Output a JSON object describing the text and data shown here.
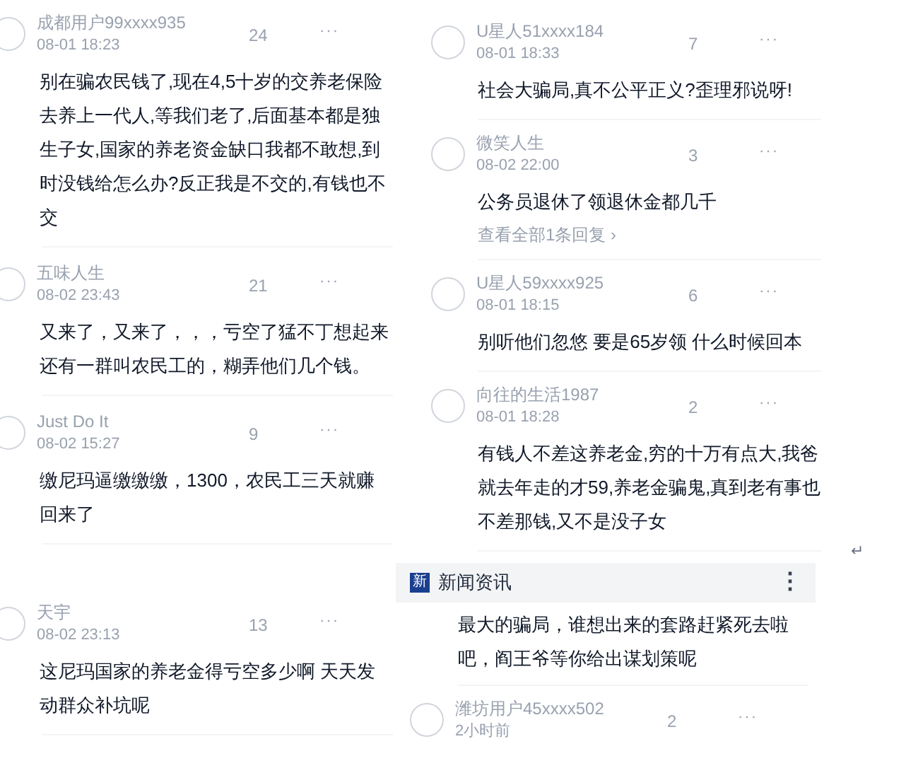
{
  "left_column": {
    "comments": [
      {
        "user": "成都用户99xxxx935",
        "time": "08-01 18:23",
        "likes": "24",
        "more": "···",
        "text": "别在骗农民钱了,现在4,5十岁的交养老保险去养上一代人,等我们老了,后面基本都是独生子女,国家的养老资金缺口我都不敢想,到时没钱给怎么办?反正我是不交的,有钱也不交"
      },
      {
        "user": "五味人生",
        "time": "08-02 23:43",
        "likes": "21",
        "more": "···",
        "text": "又来了，又来了，，，亏空了猛不丁想起来还有一群叫农民工的，糊弄他们几个钱。"
      },
      {
        "user": "Just Do It",
        "time": "08-02 15:27",
        "likes": "9",
        "more": "···",
        "text": "缴尼玛逼缴缴缴，1300，农民工三天就赚回来了"
      },
      {
        "user": "天宇",
        "time": "08-02 23:13",
        "likes": "13",
        "more": "···",
        "text": "这尼玛国家的养老金得亏空多少啊 天天发动群众补坑呢"
      }
    ]
  },
  "right_column": {
    "comments": [
      {
        "user": "U星人51xxxx184",
        "time": "08-01 18:33",
        "likes": "7",
        "more": "···",
        "text": "社会大骗局,真不公平正义?歪理邪说呀!"
      },
      {
        "user": "微笑人生",
        "time": "08-02 22:00",
        "likes": "3",
        "more": "···",
        "text": "公务员退休了领退休金都几千",
        "replies_link": "查看全部1条回复 ›"
      },
      {
        "user": "U星人59xxxx925",
        "time": "08-01 18:15",
        "likes": "6",
        "more": "···",
        "text": "别听他们忽悠 要是65岁领 什么时候回本"
      },
      {
        "user": "向往的生活1987",
        "time": "08-01 18:28",
        "likes": "2",
        "more": "···",
        "text": "有钱人不差这养老金,穷的十万有点大,我爸就去年走的才59,养老金骗鬼,真到老有事也不差那钱,又不是没子女"
      }
    ],
    "return_mark": "↵",
    "news_bar": {
      "badge": "新",
      "title": "新闻资讯",
      "menu": "⋮"
    },
    "partial_comment": {
      "text": "最大的骗局，谁想出来的套路赶紧死去啦吧，阎王爷等你给出谋划策呢"
    },
    "last_comment": {
      "user": "潍坊用户45xxxx502",
      "time": "2小时前",
      "likes": "2",
      "more": "···"
    }
  }
}
